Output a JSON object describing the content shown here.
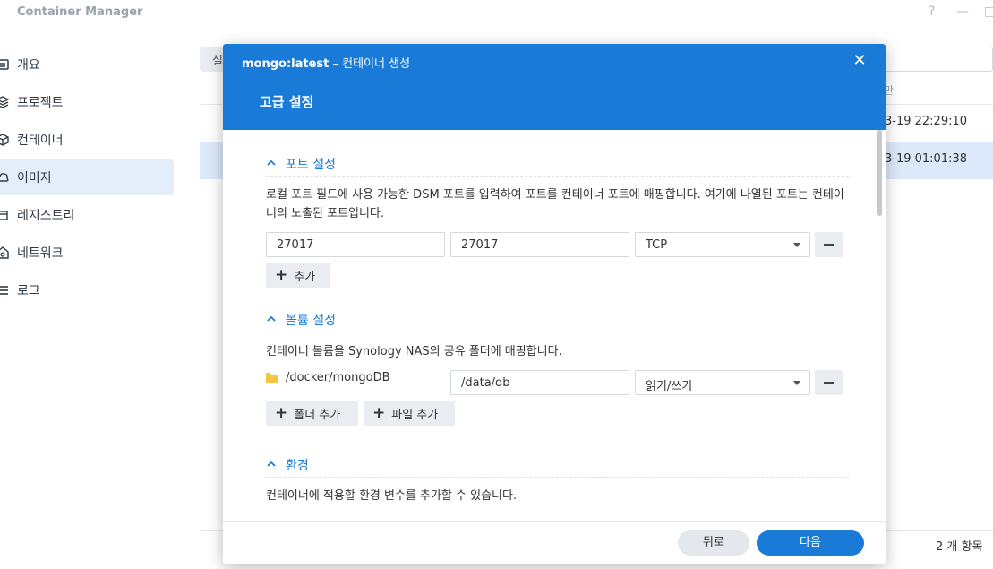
{
  "app": {
    "title": "Container Manager",
    "help_icon": "?",
    "minimize_icon": "—",
    "maximize_icon": "□"
  },
  "sidebar": {
    "items": [
      {
        "label": "개요",
        "icon": "overview-icon"
      },
      {
        "label": "프로젝트",
        "icon": "project-icon"
      },
      {
        "label": "컨테이너",
        "icon": "container-icon"
      },
      {
        "label": "이미지",
        "icon": "image-icon",
        "active": true
      },
      {
        "label": "레지스트리",
        "icon": "registry-icon"
      },
      {
        "label": "네트워크",
        "icon": "network-icon"
      },
      {
        "label": "로그",
        "icon": "log-icon"
      }
    ]
  },
  "content": {
    "toolbar_button": "실",
    "column_head_left": "",
    "column_head_right": "만",
    "rows": [
      {
        "time": "3-19 22:29:10"
      },
      {
        "time": "3-19 01:01:38"
      }
    ],
    "item_count": "2 개 항목"
  },
  "modal": {
    "title": "mongo:latest",
    "title_sub": " – 컨테이너 생성",
    "subtitle": "고급 설정",
    "accent": "#1a7ad8",
    "port_section": {
      "title": "포트 설정",
      "description": "로컬 포트 필드에 사용 가능한 DSM 포트를 입력하여 포트를 컨테이너 포트에 매핑합니다. 여기에 나열된 포트는 컨테이너의 노출된 포트입니다.",
      "local_port": "27017",
      "container_port": "27017",
      "protocol": "TCP",
      "add_label": "추가"
    },
    "volume_section": {
      "title": "볼륨 설정",
      "description": "컨테이너 볼륨을 Synology NAS의 공유 폴더에 매핑합니다.",
      "folder": "/docker/mongoDB",
      "mount_path": "/data/db",
      "permission": "읽기/쓰기",
      "add_folder_label": "폴더 추가",
      "add_file_label": "파일 추가"
    },
    "env_section": {
      "title": "환경",
      "description": "컨테이너에 적용할 환경 변수를 추가할 수 있습니다."
    },
    "back_label": "뒤로",
    "next_label": "다음"
  }
}
